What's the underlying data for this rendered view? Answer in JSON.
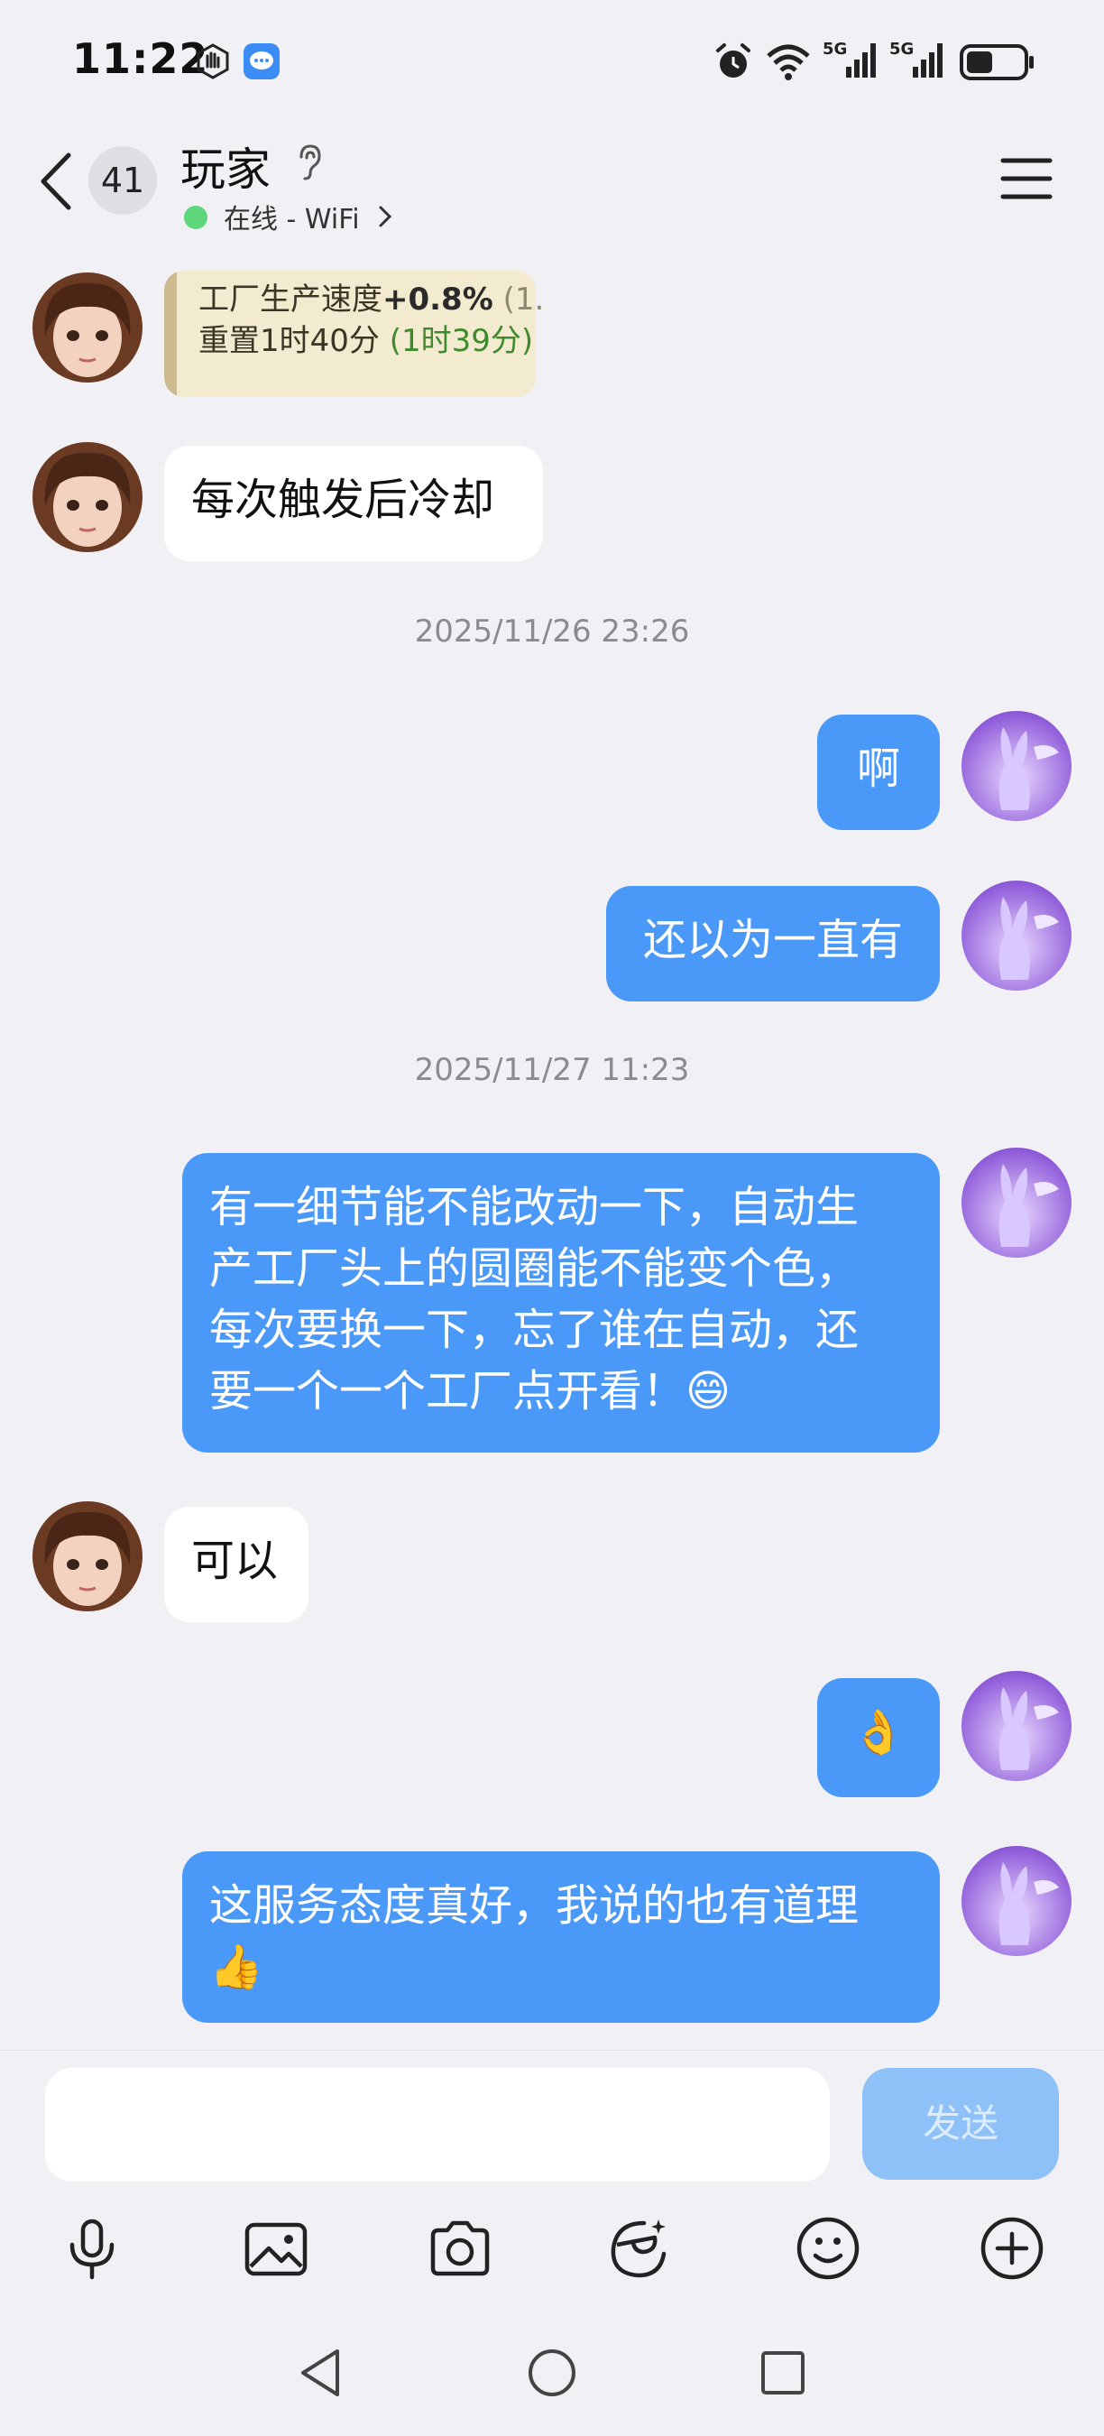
{
  "status_bar": {
    "time": "11:22",
    "icons": [
      "hand-icon",
      "message-app-icon",
      "alarm-icon",
      "wifi-icon",
      "5g-signal-icon",
      "5g-signal-icon",
      "battery-icon"
    ]
  },
  "header": {
    "unread_count": "41",
    "contact_name": "玩家",
    "online_status": "在线 - WiFi",
    "icons": [
      "back-icon",
      "hearing-icon",
      "chevron-right-icon",
      "menu-icon"
    ]
  },
  "messages": [
    {
      "side": "in",
      "type": "image",
      "line1_prefix": "工厂生产速度",
      "line1_bold": "+0.8%",
      "line1_suffix": "(1.",
      "line2_prefix": "重置1时40分",
      "line2_green": "(1时39分)"
    },
    {
      "side": "in",
      "text": "每次触发后冷却"
    },
    {
      "type": "timestamp",
      "text": "2025/11/26 23:26"
    },
    {
      "side": "out",
      "text": "啊"
    },
    {
      "side": "out",
      "text": "还以为一直有"
    },
    {
      "type": "timestamp",
      "text": "2025/11/27 11:23"
    },
    {
      "side": "out",
      "lines": [
        "有一细节能不能改动一下，自动生",
        "产工厂头上的圆圈能不能变个色，",
        "每次要换一下，忘了谁在自动，还",
        "要一个一个工厂点开看！😄"
      ]
    },
    {
      "side": "in",
      "text": "可以"
    },
    {
      "side": "out",
      "text": "👌"
    },
    {
      "side": "out",
      "lines": [
        "这服务态度真好，我说的也有道理",
        "👍"
      ]
    }
  ],
  "input": {
    "placeholder": "",
    "send_label": "发送"
  },
  "toolbar": [
    "microphone-icon",
    "image-icon",
    "camera-icon",
    "sticker-icon",
    "emoji-icon",
    "plus-icon"
  ],
  "nav_bar": [
    "back-nav-icon",
    "home-nav-icon",
    "recents-nav-icon"
  ],
  "colors": {
    "outgoing_bubble": "#4a98f7",
    "incoming_bubble": "#ffffff",
    "background": "#f0f0f5",
    "online_dot": "#5ed67c"
  }
}
